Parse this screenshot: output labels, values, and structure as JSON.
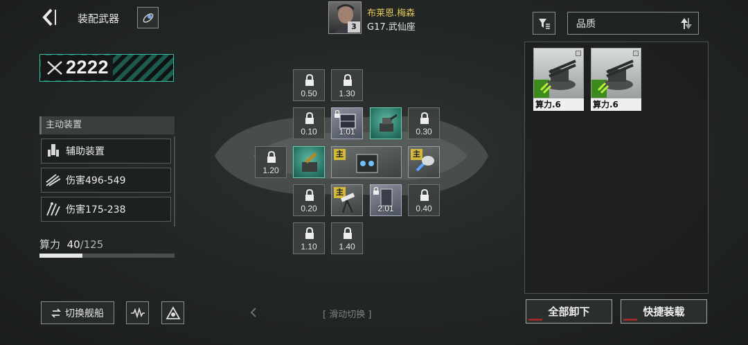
{
  "header": {
    "title": "装配武器",
    "back_icon": "back-arrow-icon",
    "guide_icon": "rocket-icon"
  },
  "pilot": {
    "name": "布莱恩.梅森",
    "level": "3",
    "ship": "G17.武仙座"
  },
  "power": {
    "value": "2222",
    "icon": "crossed-swords-icon"
  },
  "active_device": {
    "label": "主动装置",
    "rows": [
      {
        "icon": "support-device-icon",
        "text": "辅助装置"
      },
      {
        "icon": "missile-icon",
        "text": "伤害496-549"
      },
      {
        "icon": "flak-icon",
        "text": "伤害175-238"
      }
    ]
  },
  "compute": {
    "label": "算力",
    "current": "40",
    "max": "/125",
    "fraction": 0.32
  },
  "bottom_left": {
    "switch_label": "切换舰船",
    "switch_icon": "swap-icon",
    "btn2_icon": "wave-icon",
    "btn3_icon": "triangle-emblem-icon"
  },
  "slots": {
    "r0c0": "0.50",
    "r0c1": "1.30",
    "r1c0": "0.10",
    "r1c1": "1.01",
    "r1c3": "0.30",
    "r2left": "1.20",
    "r3c0": "0.20",
    "r3c2": "2.01",
    "r3c3": "0.40",
    "r4c0": "1.10",
    "r4c1": "1.40",
    "main_tag": "主"
  },
  "swipe_hint": "滑动切换",
  "sort": {
    "filter_icon": "filter-icon",
    "quality_label": "品质",
    "sort_icon": "sort-arrows-icon"
  },
  "inventory": [
    {
      "label": "算力.6"
    },
    {
      "label": "算力.6"
    }
  ],
  "actions": {
    "unequip_all": "全部卸下",
    "quick_equip": "快捷装载"
  },
  "colors": {
    "accent_teal": "#37bfa3",
    "pilot_gold": "#e3c85a",
    "main_tag": "#d4b83a",
    "rarity_green": "#3d8a1c"
  }
}
